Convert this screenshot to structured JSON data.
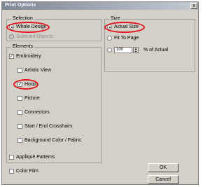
{
  "dialog": {
    "title": "Print Options",
    "close": "x"
  },
  "selection": {
    "legend": "Selection",
    "whole_design": "Whole Design",
    "selected_objects": "Selected Objects"
  },
  "size": {
    "legend": "Size",
    "actual_size": "Actual Size",
    "fit_to_page": "Fit To Page",
    "percent_value": "100",
    "percent_label": "% of Actual"
  },
  "elements": {
    "legend": "Elements",
    "embroidery": "Embroidery",
    "artistic_view": "Artistic View",
    "hoop": "Hoop",
    "picture": "Picture",
    "connectors": "Connectors",
    "crosshairs": "Start / End Crosshairs",
    "background": "Background Color / Fabric"
  },
  "extras": {
    "applique": "Appliqué Patterns",
    "color_film": "Color Film"
  },
  "buttons": {
    "ok": "OK",
    "cancel": "Cancel"
  },
  "colors": {
    "annotation": "#e0141e"
  }
}
